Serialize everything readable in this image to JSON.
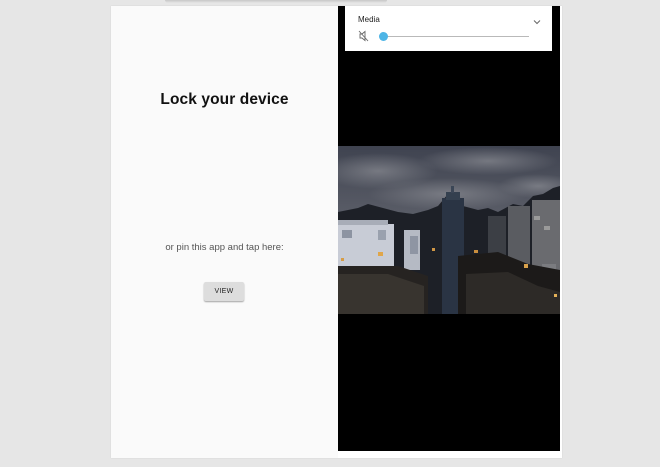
{
  "lock_screen": {
    "title": "Lock your device",
    "pin_prompt": "or pin this app and tap here:",
    "view_button_label": "VIEW"
  },
  "volume_panel": {
    "label": "Media",
    "volume_level": 0.0,
    "mute_icon": "speaker-muted-icon",
    "expand_icon": "chevron-down-icon",
    "accent_color": "#4eb5e6"
  },
  "video": {
    "content": "night-city-skyline"
  },
  "colors": {
    "background": "#e6e6e6",
    "left_pane": "#fafafa",
    "video_background": "#000000",
    "button": "#dddddd"
  }
}
